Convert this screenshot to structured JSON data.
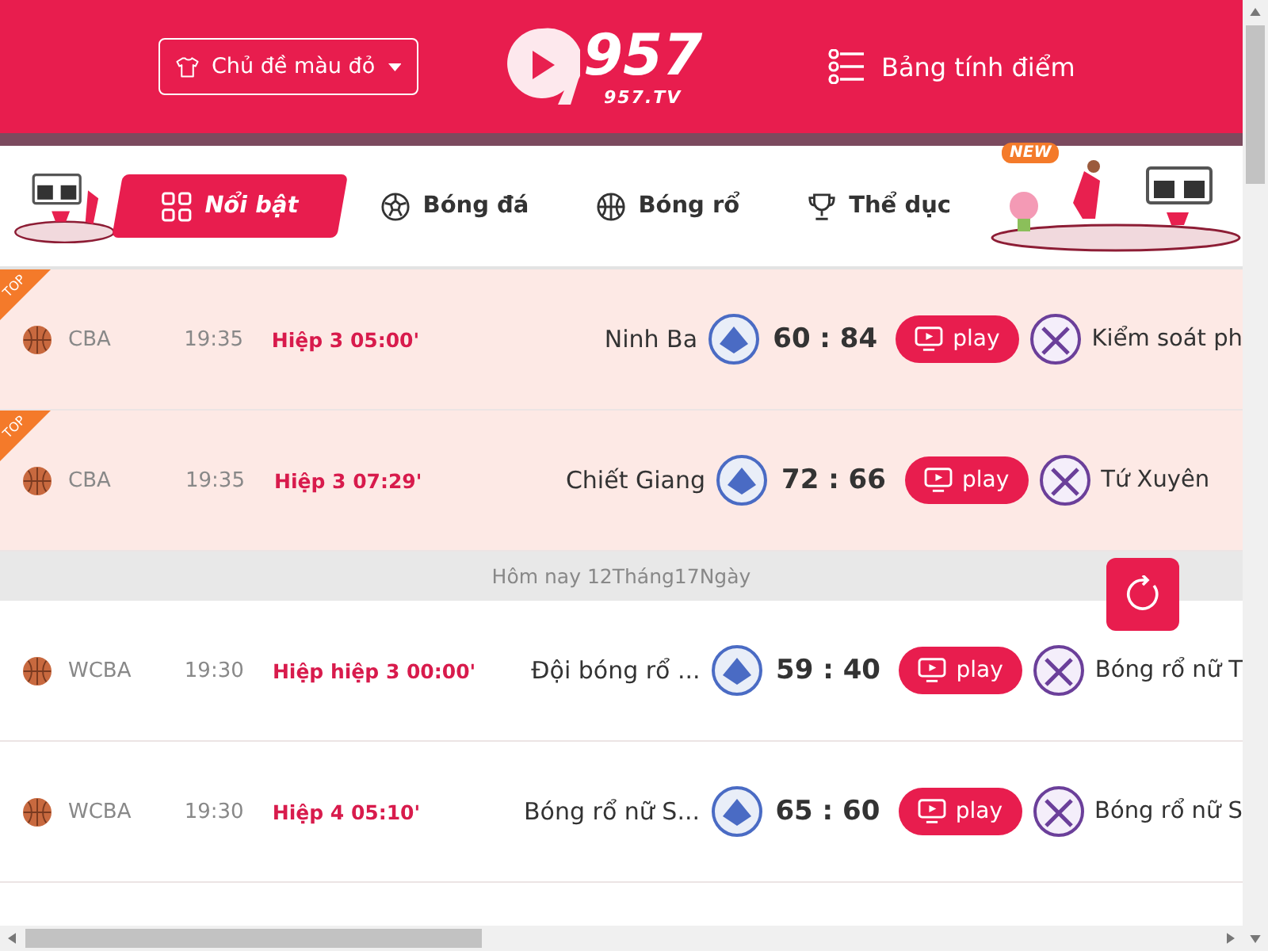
{
  "header": {
    "theme_dropdown": "Chủ đề màu đỏ",
    "logo": {
      "number": "957",
      "domain": "957.TV"
    },
    "standings_link": "Bảng tính điểm"
  },
  "tabs": [
    {
      "label": "Nổi bật",
      "selected": true
    },
    {
      "label": "Bóng đá",
      "selected": false
    },
    {
      "label": "Bóng rổ",
      "selected": false
    },
    {
      "label": "Thể dục",
      "selected": false
    }
  ],
  "badge_new": "NEW",
  "matches_top": [
    {
      "top": true,
      "badge": "TOP",
      "league": "CBA",
      "time": "19:35",
      "status": "Hiệp 3 05:00'",
      "home": "Ninh Ba",
      "score": "60 : 84",
      "play": "play",
      "away": "Kiểm soát ph"
    },
    {
      "top": true,
      "badge": "TOP",
      "league": "CBA",
      "time": "19:35",
      "status": "Hiệp 3 07:29'",
      "home": "Chiết Giang",
      "score": "72 : 66",
      "play": "play",
      "away": "Tứ Xuyên"
    }
  ],
  "date_divider": "Hôm nay 12Tháng17Ngày",
  "matches_today": [
    {
      "top": false,
      "league": "WCBA",
      "time": "19:30",
      "status": "Hiệp hiệp 3 00:00'",
      "home": "Đội bóng rổ ...",
      "score": "59 : 40",
      "play": "play",
      "away": "Bóng rổ nữ T"
    },
    {
      "top": false,
      "league": "WCBA",
      "time": "19:30",
      "status": "Hiệp 4 05:10'",
      "home": "Bóng rổ nữ S...",
      "score": "65 : 60",
      "play": "play",
      "away": "Bóng rổ nữ S"
    }
  ]
}
